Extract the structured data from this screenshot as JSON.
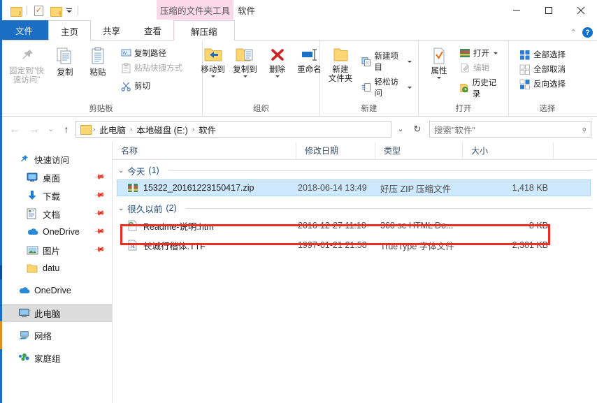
{
  "window": {
    "title_context_group": "压缩的文件夹工具",
    "title_text": "软件",
    "minimize": "–",
    "maximize": "□",
    "close": "✕",
    "collapse_ribbon": "⌃",
    "help": "?"
  },
  "quick_access": {
    "items": [
      {
        "name": "folder-icon",
        "label": ""
      },
      {
        "name": "properties-icon",
        "label": ""
      },
      {
        "name": "new-folder-icon",
        "label": ""
      },
      {
        "name": "customize-dropdown",
        "label": ""
      }
    ]
  },
  "tabs": [
    {
      "id": "file",
      "label": "文件",
      "state": "file"
    },
    {
      "id": "home",
      "label": "主页",
      "state": "active"
    },
    {
      "id": "share",
      "label": "共享",
      "state": "normal"
    },
    {
      "id": "view",
      "label": "查看",
      "state": "normal"
    },
    {
      "id": "extract",
      "label": "解压缩",
      "state": "contextual"
    }
  ],
  "ribbon": {
    "groups": [
      {
        "id": "clipboard",
        "label": "剪贴板",
        "big_buttons": [
          {
            "label": "固定到\"快\n速访问\"",
            "icon": "pin-icon",
            "disabled": true
          },
          {
            "label": "复制",
            "icon": "copy-icon",
            "disabled": false
          },
          {
            "label": "粘贴",
            "icon": "paste-icon",
            "disabled": false
          }
        ],
        "small_buttons": [
          {
            "label": "复制路径",
            "icon": "copy-path-icon",
            "disabled": false
          },
          {
            "label": "粘贴快捷方式",
            "icon": "paste-shortcut-icon",
            "disabled": true
          },
          {
            "label": "剪切",
            "icon": "cut-icon",
            "disabled": false
          }
        ]
      },
      {
        "id": "organize",
        "label": "组织",
        "big_buttons": [
          {
            "label": "移动到",
            "icon": "move-to-icon",
            "dropdown": true
          },
          {
            "label": "复制到",
            "icon": "copy-to-icon",
            "dropdown": true
          },
          {
            "label": "删除",
            "icon": "delete-icon",
            "dropdown": true
          },
          {
            "label": "重命名",
            "icon": "rename-icon",
            "dropdown": false
          }
        ]
      },
      {
        "id": "new",
        "label": "新建",
        "big_buttons": [
          {
            "label": "新建\n文件夹",
            "icon": "new-folder-icon",
            "dropdown": false
          }
        ],
        "small_buttons": [
          {
            "label": "新建项目",
            "icon": "new-item-icon",
            "dropdown": true
          },
          {
            "label": "轻松访问",
            "icon": "easy-access-icon",
            "dropdown": true
          }
        ]
      },
      {
        "id": "open",
        "label": "打开",
        "big_buttons": [
          {
            "label": "属性",
            "icon": "properties-icon",
            "dropdown": true
          }
        ],
        "small_buttons": [
          {
            "label": "打开",
            "icon": "open-icon",
            "dropdown": true
          },
          {
            "label": "编辑",
            "icon": "edit-icon",
            "disabled": true
          },
          {
            "label": "历史记录",
            "icon": "history-icon",
            "disabled": false
          }
        ]
      },
      {
        "id": "select",
        "label": "选择",
        "small_buttons": [
          {
            "label": "全部选择",
            "icon": "select-all-icon"
          },
          {
            "label": "全部取消",
            "icon": "select-none-icon"
          },
          {
            "label": "反向选择",
            "icon": "invert-selection-icon"
          }
        ]
      }
    ]
  },
  "address": {
    "back": "←",
    "forward": "→",
    "recent": "⌄",
    "up": "↑",
    "breadcrumbs": [
      "此电脑",
      "本地磁盘 (E:)",
      "软件"
    ],
    "separator": "›",
    "dropdown": "⌄",
    "refresh": "↻",
    "search_placeholder": "搜索\"软件\"",
    "search_value": ""
  },
  "nav_pane": {
    "items": [
      {
        "label": "快速访问",
        "icon": "quick-access-pin-icon",
        "indent": false,
        "pinned": false,
        "selected": false
      },
      {
        "label": "桌面",
        "icon": "desktop-icon",
        "indent": true,
        "pinned": true,
        "selected": false
      },
      {
        "label": "下载",
        "icon": "downloads-icon",
        "indent": true,
        "pinned": true,
        "selected": false
      },
      {
        "label": "文档",
        "icon": "documents-icon",
        "indent": true,
        "pinned": true,
        "selected": false
      },
      {
        "label": "OneDrive",
        "icon": "onedrive-icon",
        "indent": true,
        "pinned": true,
        "selected": false
      },
      {
        "label": "图片",
        "icon": "pictures-icon",
        "indent": true,
        "pinned": true,
        "selected": false
      },
      {
        "label": "datu",
        "icon": "folder-icon",
        "indent": true,
        "pinned": false,
        "selected": false
      },
      {
        "label": "OneDrive",
        "icon": "onedrive-icon",
        "indent": false,
        "pinned": false,
        "selected": false
      },
      {
        "label": "此电脑",
        "icon": "this-pc-icon",
        "indent": false,
        "pinned": false,
        "selected": true
      },
      {
        "label": "网络",
        "icon": "network-icon",
        "indent": false,
        "pinned": false,
        "selected": false
      },
      {
        "label": "家庭组",
        "icon": "homegroup-icon",
        "indent": false,
        "pinned": false,
        "selected": false
      }
    ]
  },
  "file_list": {
    "columns": [
      {
        "key": "name",
        "label": "名称",
        "sorted": false
      },
      {
        "key": "date",
        "label": "修改日期",
        "sorted": true
      },
      {
        "key": "type",
        "label": "类型",
        "sorted": false
      },
      {
        "key": "size",
        "label": "大小",
        "sorted": false
      }
    ],
    "groups": [
      {
        "title": "今天",
        "count": "(1)",
        "rows": [
          {
            "name": "15322_20161223150417.zip",
            "date": "2018-06-14 13:49",
            "type": "好压 ZIP 压缩文件",
            "size": "1,418 KB",
            "icon": "zip-icon",
            "selected": true,
            "highlighted": false
          }
        ]
      },
      {
        "title": "很久以前",
        "count": "(2)",
        "rows": [
          {
            "name": "Readme-说明.htm",
            "date": "2016-12-27 11:10",
            "type": "360 se HTML Do...",
            "size": "8 KB",
            "icon": "html-icon",
            "selected": false,
            "highlighted": false
          },
          {
            "name": "长城行楷体.TTF",
            "date": "1997-01-21 21:58",
            "type": "TrueType 字体文件",
            "size": "2,381 KB",
            "icon": "font-icon",
            "selected": false,
            "highlighted": true
          }
        ]
      }
    ]
  },
  "annotation": {
    "highlight_color": "#ee2b24",
    "note": ""
  }
}
